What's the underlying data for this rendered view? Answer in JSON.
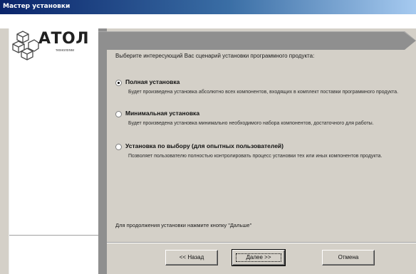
{
  "window": {
    "title": "Мастер установки"
  },
  "logo": {
    "brand": "АТОЛ",
    "subtitle": "технологии"
  },
  "wizard": {
    "intro": "Выберите интересующий Вас сценарий установки программного продукта:",
    "selected_option": "full",
    "options": [
      {
        "id": "full",
        "label": "Полная установка",
        "description": "Будет произведена установка абсолютно всех компонентов, входящих в комплект поставки программного продукта."
      },
      {
        "id": "minimal",
        "label": "Минимальная установка",
        "description": "Будет произведена установка минимально необходимого набора компонентов, достаточного для работы."
      },
      {
        "id": "custom",
        "label": "Установка по выбору (для опытных пользователей)",
        "description": "Позволяет пользователю полностью контролировать процесс установки тех или иных компонентов продукта."
      }
    ],
    "footer": "Для продолжения установки нажмите кнопку \"Дальше\""
  },
  "buttons": {
    "back": "<< Назад",
    "next": "Далее >>",
    "cancel": "Отмена"
  },
  "colors": {
    "title_gradient_start": "#0a246a",
    "title_gradient_end": "#a6caf0",
    "dialog_face": "#d4d0c8",
    "arrow_gray": "#8f8f8f"
  }
}
